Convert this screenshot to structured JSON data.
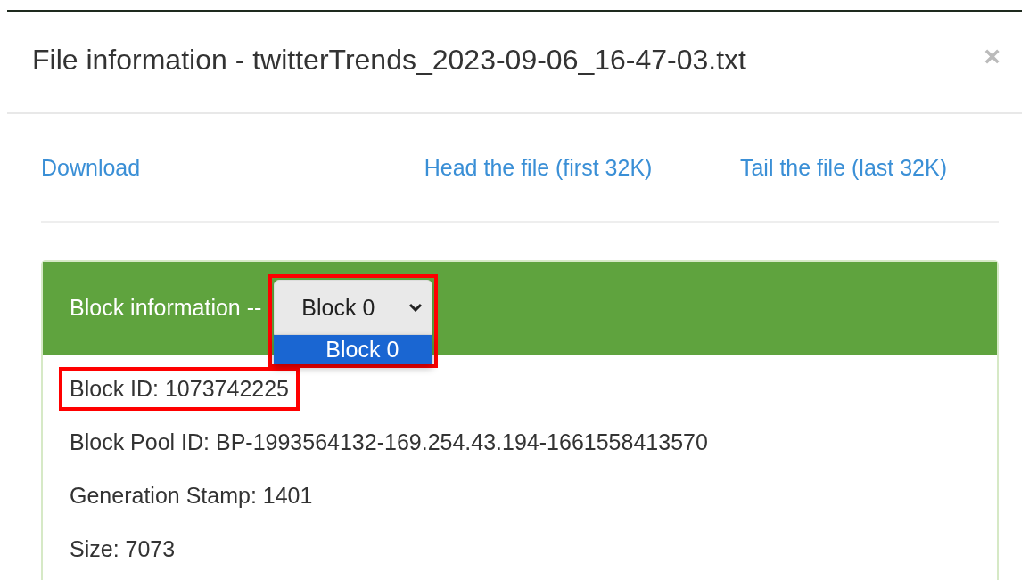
{
  "modal": {
    "title": "File information - twitterTrends_2023-09-06_16-47-03.txt",
    "close": "×"
  },
  "links": [
    "Download",
    "Head the file (first 32K)",
    "Tail the file (last 32K)"
  ],
  "block_panel": {
    "heading": "Block information --",
    "select": {
      "value": "Block 0",
      "expanded": true,
      "highlighted": true,
      "options": [
        {
          "label": "Block 0",
          "selected": true
        }
      ]
    },
    "fields": [
      {
        "text": "Block ID: 1073742225",
        "highlighted": true
      },
      {
        "text": "Block Pool ID: BP-1993564132-169.254.43.194-1661558413570",
        "highlighted": false
      },
      {
        "text": "Generation Stamp: 1401",
        "highlighted": false
      },
      {
        "text": "Size: 7073",
        "highlighted": false
      }
    ]
  }
}
